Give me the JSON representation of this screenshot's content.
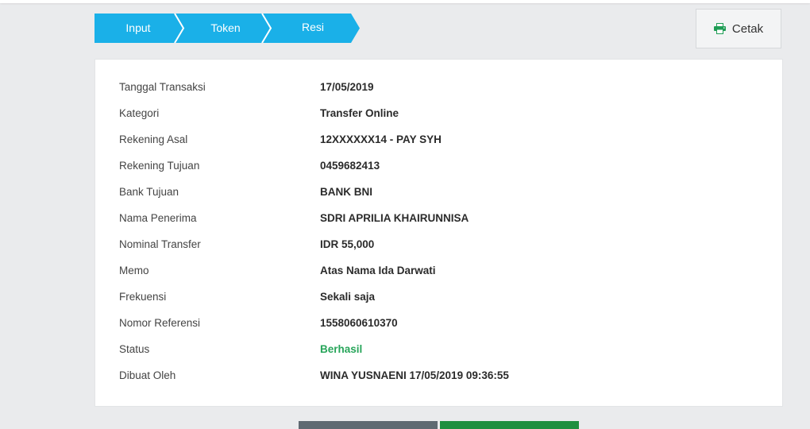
{
  "steps": [
    {
      "label": "Input"
    },
    {
      "label": "Token"
    },
    {
      "label": "Resi"
    }
  ],
  "colors": {
    "step_bg": "#1ab0e8",
    "step_separator": "#ffffff",
    "success": "#27a55a",
    "print_icon": "#1f9d55"
  },
  "print_button": {
    "label": "Cetak",
    "icon": "printer-icon"
  },
  "receipt": {
    "rows": [
      {
        "label": "Tanggal Transaksi",
        "value": "17/05/2019"
      },
      {
        "label": "Kategori",
        "value": "Transfer Online"
      },
      {
        "label": "Rekening Asal",
        "value": "12XXXXXX14 - PAY SYH"
      },
      {
        "label": "Rekening Tujuan",
        "value": "0459682413"
      },
      {
        "label": "Bank Tujuan",
        "value": "BANK BNI"
      },
      {
        "label": "Nama Penerima",
        "value": "SDRI APRILIA KHAIRUNNISA"
      },
      {
        "label": "Nominal Transfer",
        "value": "IDR 55,000"
      },
      {
        "label": "Memo",
        "value": "Atas Nama Ida Darwati"
      },
      {
        "label": "Frekuensi",
        "value": "Sekali saja"
      },
      {
        "label": "Nomor Referensi",
        "value": "1558060610370"
      },
      {
        "label": "Status",
        "value": "Berhasil"
      },
      {
        "label": "Dibuat Oleh",
        "value": "WINA YUSNAENI 17/05/2019 09:36:55"
      }
    ]
  }
}
